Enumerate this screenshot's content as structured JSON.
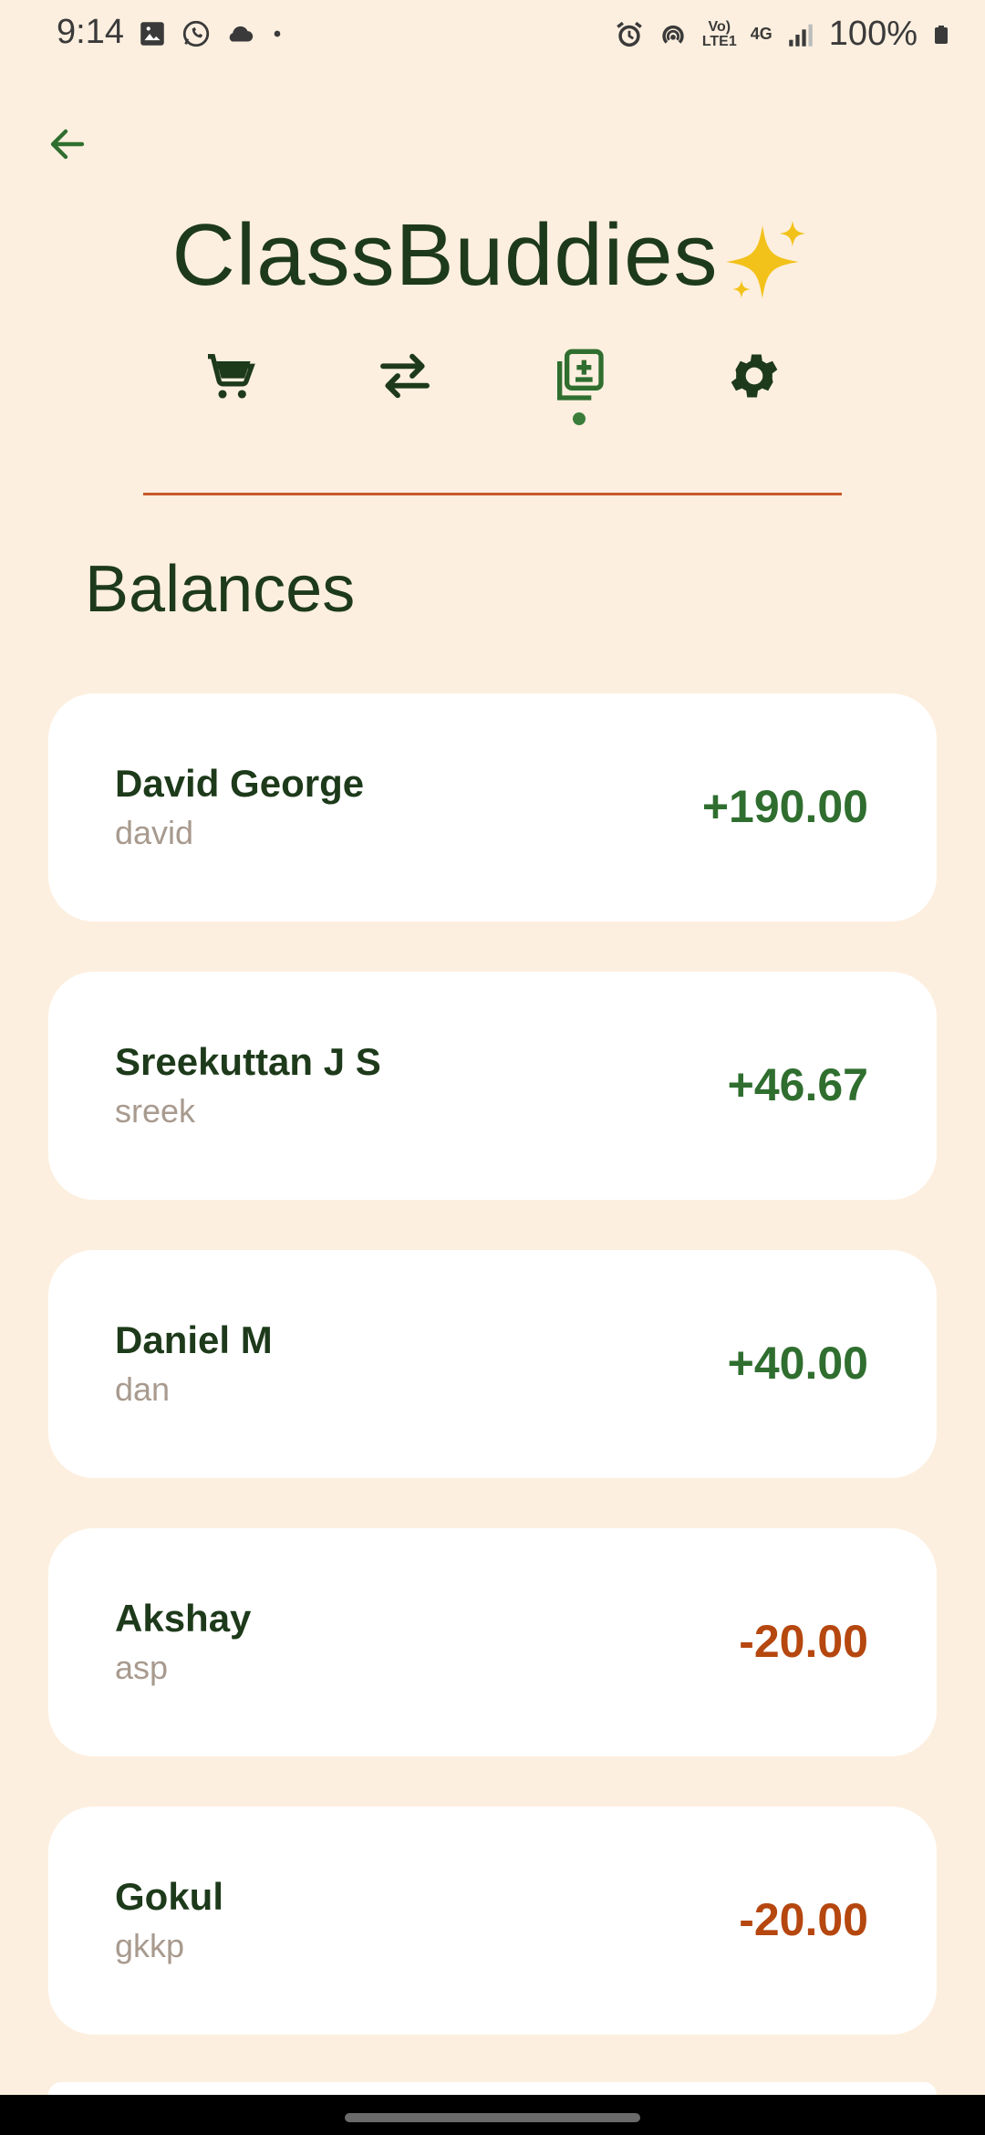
{
  "status_bar": {
    "time": "9:14",
    "network": "4G",
    "volte": "Vo) LTE1",
    "battery": "100%"
  },
  "header": {
    "title": "ClassBuddies",
    "title_emoji": "sparkles-icon",
    "nav_tabs": [
      {
        "icon": "cart-icon",
        "active": false
      },
      {
        "icon": "swap-icon",
        "active": false
      },
      {
        "icon": "note-add-icon",
        "active": true
      },
      {
        "icon": "gear-icon",
        "active": false
      }
    ]
  },
  "section": {
    "title": "Balances"
  },
  "balances": [
    {
      "name": "David George",
      "handle": "david",
      "amount": "+190.00",
      "sign": "positive"
    },
    {
      "name": "Sreekuttan J S",
      "handle": "sreek",
      "amount": "+46.67",
      "sign": "positive"
    },
    {
      "name": "Daniel M",
      "handle": "dan",
      "amount": "+40.00",
      "sign": "positive"
    },
    {
      "name": "Akshay",
      "handle": "asp",
      "amount": "-20.00",
      "sign": "negative"
    },
    {
      "name": "Gokul",
      "handle": "gkkp",
      "amount": "-20.00",
      "sign": "negative"
    }
  ],
  "colors": {
    "background": "#fdefdf",
    "primary_green": "#2f6e2f",
    "negative_orange": "#b5470f",
    "divider": "#c8582a"
  }
}
